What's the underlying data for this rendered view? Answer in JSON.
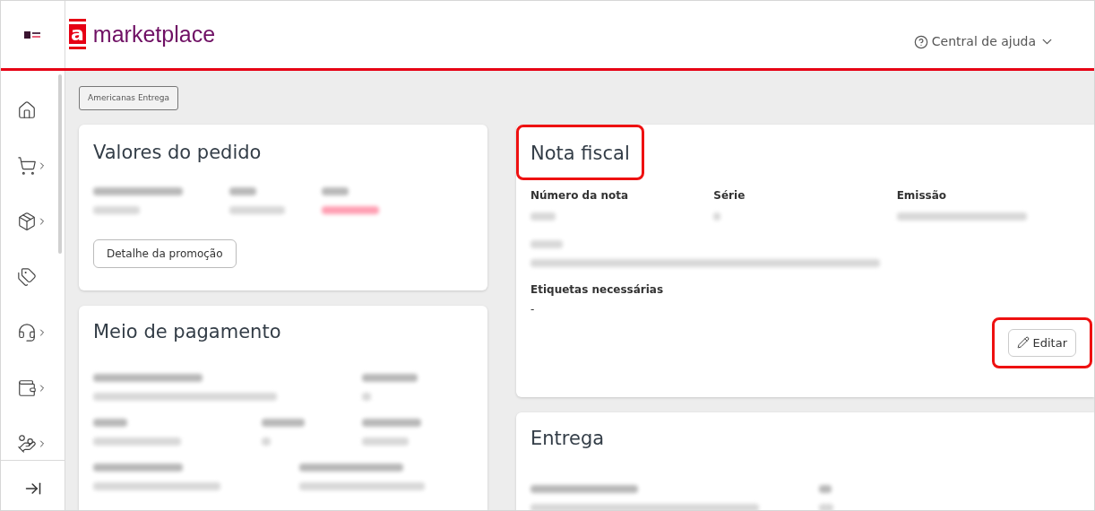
{
  "header": {
    "logo_mark": "a",
    "logo_text": "marketplace",
    "help": "Central de ajuda"
  },
  "sidebar": {
    "items": [
      {
        "kind": "home",
        "submenu": false
      },
      {
        "kind": "cart",
        "submenu": true
      },
      {
        "kind": "box",
        "submenu": true
      },
      {
        "kind": "tags",
        "submenu": false
      },
      {
        "kind": "support",
        "submenu": true
      },
      {
        "kind": "wallet",
        "submenu": true
      },
      {
        "kind": "payment",
        "submenu": true
      }
    ]
  },
  "tag": "Americanas Entrega",
  "order_values": {
    "title": "Valores do pedido",
    "button": "Detalhe da promoção"
  },
  "payment": {
    "title": "Meio de pagamento"
  },
  "invoice": {
    "title": "Nota fiscal",
    "highlighted": true,
    "fields": [
      {
        "label": "Número da nota"
      },
      {
        "label": "Série"
      },
      {
        "label": "Emissão"
      }
    ],
    "tags_label": "Etiquetas necessárias",
    "tags_value": "-",
    "button": {
      "label": "Editar",
      "highlighted": true
    }
  },
  "delivery": {
    "title": "Entrega"
  }
}
